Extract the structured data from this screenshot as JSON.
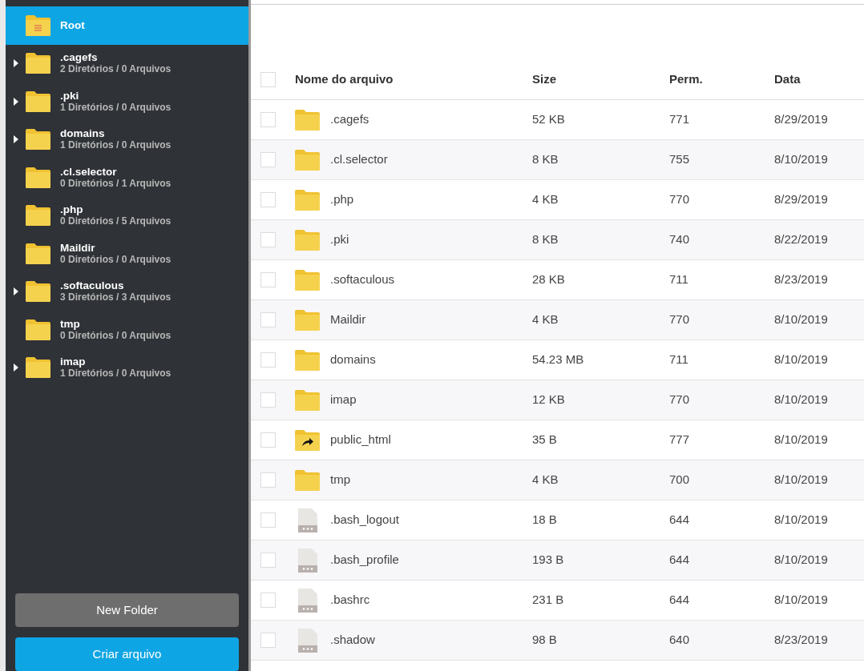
{
  "sidebar": {
    "items": [
      {
        "name": "Root",
        "kind": "root",
        "selected": true,
        "expandable": false
      },
      {
        "name": ".cagefs",
        "info": "2 Diretórios / 0 Arquivos",
        "kind": "folder",
        "selected": false,
        "expandable": true
      },
      {
        "name": ".pki",
        "info": "1 Diretórios / 0 Arquivos",
        "kind": "folder",
        "selected": false,
        "expandable": true
      },
      {
        "name": "domains",
        "info": "1 Diretórios / 0 Arquivos",
        "kind": "folder",
        "selected": false,
        "expandable": true
      },
      {
        "name": ".cl.selector",
        "info": "0 Diretórios / 1 Arquivos",
        "kind": "folder",
        "selected": false,
        "expandable": false
      },
      {
        "name": ".php",
        "info": "0 Diretórios / 5 Arquivos",
        "kind": "folder",
        "selected": false,
        "expandable": false
      },
      {
        "name": "Maildir",
        "info": "0 Diretórios / 0 Arquivos",
        "kind": "folder",
        "selected": false,
        "expandable": false
      },
      {
        "name": ".softaculous",
        "info": "3 Diretórios / 3 Arquivos",
        "kind": "folder",
        "selected": false,
        "expandable": true
      },
      {
        "name": "tmp",
        "info": "0 Diretórios / 0 Arquivos",
        "kind": "folder",
        "selected": false,
        "expandable": false
      },
      {
        "name": "imap",
        "info": "1 Diretórios / 0 Arquivos",
        "kind": "folder",
        "selected": false,
        "expandable": true
      }
    ],
    "buttons": [
      {
        "label": "New Folder",
        "kind": "secondary"
      },
      {
        "label": "Criar arquivo",
        "kind": "primary"
      }
    ]
  },
  "table": {
    "select_all": {
      "checked": false
    },
    "columns": [
      "Nome do arquivo",
      "Size",
      "Perm.",
      "Data"
    ],
    "rows": [
      {
        "name": ".cagefs",
        "size": "52 KB",
        "perm": "771",
        "date": "8/29/2019",
        "kind": "folder",
        "checked": false
      },
      {
        "name": ".cl.selector",
        "size": "8 KB",
        "perm": "755",
        "date": "8/10/2019",
        "kind": "folder",
        "checked": false
      },
      {
        "name": ".php",
        "size": "4 KB",
        "perm": "770",
        "date": "8/29/2019",
        "kind": "folder",
        "checked": false
      },
      {
        "name": ".pki",
        "size": "8 KB",
        "perm": "740",
        "date": "8/22/2019",
        "kind": "folder",
        "checked": false
      },
      {
        "name": ".softaculous",
        "size": "28 KB",
        "perm": "711",
        "date": "8/23/2019",
        "kind": "folder",
        "checked": false
      },
      {
        "name": "Maildir",
        "size": "4 KB",
        "perm": "770",
        "date": "8/10/2019",
        "kind": "folder",
        "checked": false
      },
      {
        "name": "domains",
        "size": "54.23 MB",
        "perm": "711",
        "date": "8/10/2019",
        "kind": "folder",
        "checked": false
      },
      {
        "name": "imap",
        "size": "12 KB",
        "perm": "770",
        "date": "8/10/2019",
        "kind": "folder",
        "checked": false
      },
      {
        "name": "public_html",
        "size": "35 B",
        "perm": "777",
        "date": "8/10/2019",
        "kind": "link",
        "checked": false
      },
      {
        "name": "tmp",
        "size": "4 KB",
        "perm": "700",
        "date": "8/10/2019",
        "kind": "folder",
        "checked": false
      },
      {
        "name": ".bash_logout",
        "size": "18 B",
        "perm": "644",
        "date": "8/10/2019",
        "kind": "file",
        "checked": false
      },
      {
        "name": ".bash_profile",
        "size": "193 B",
        "perm": "644",
        "date": "8/10/2019",
        "kind": "file",
        "checked": false
      },
      {
        "name": ".bashrc",
        "size": "231 B",
        "perm": "644",
        "date": "8/10/2019",
        "kind": "file",
        "checked": false
      },
      {
        "name": ".shadow",
        "size": "98 B",
        "perm": "640",
        "date": "8/23/2019",
        "kind": "file",
        "checked": false
      }
    ]
  }
}
